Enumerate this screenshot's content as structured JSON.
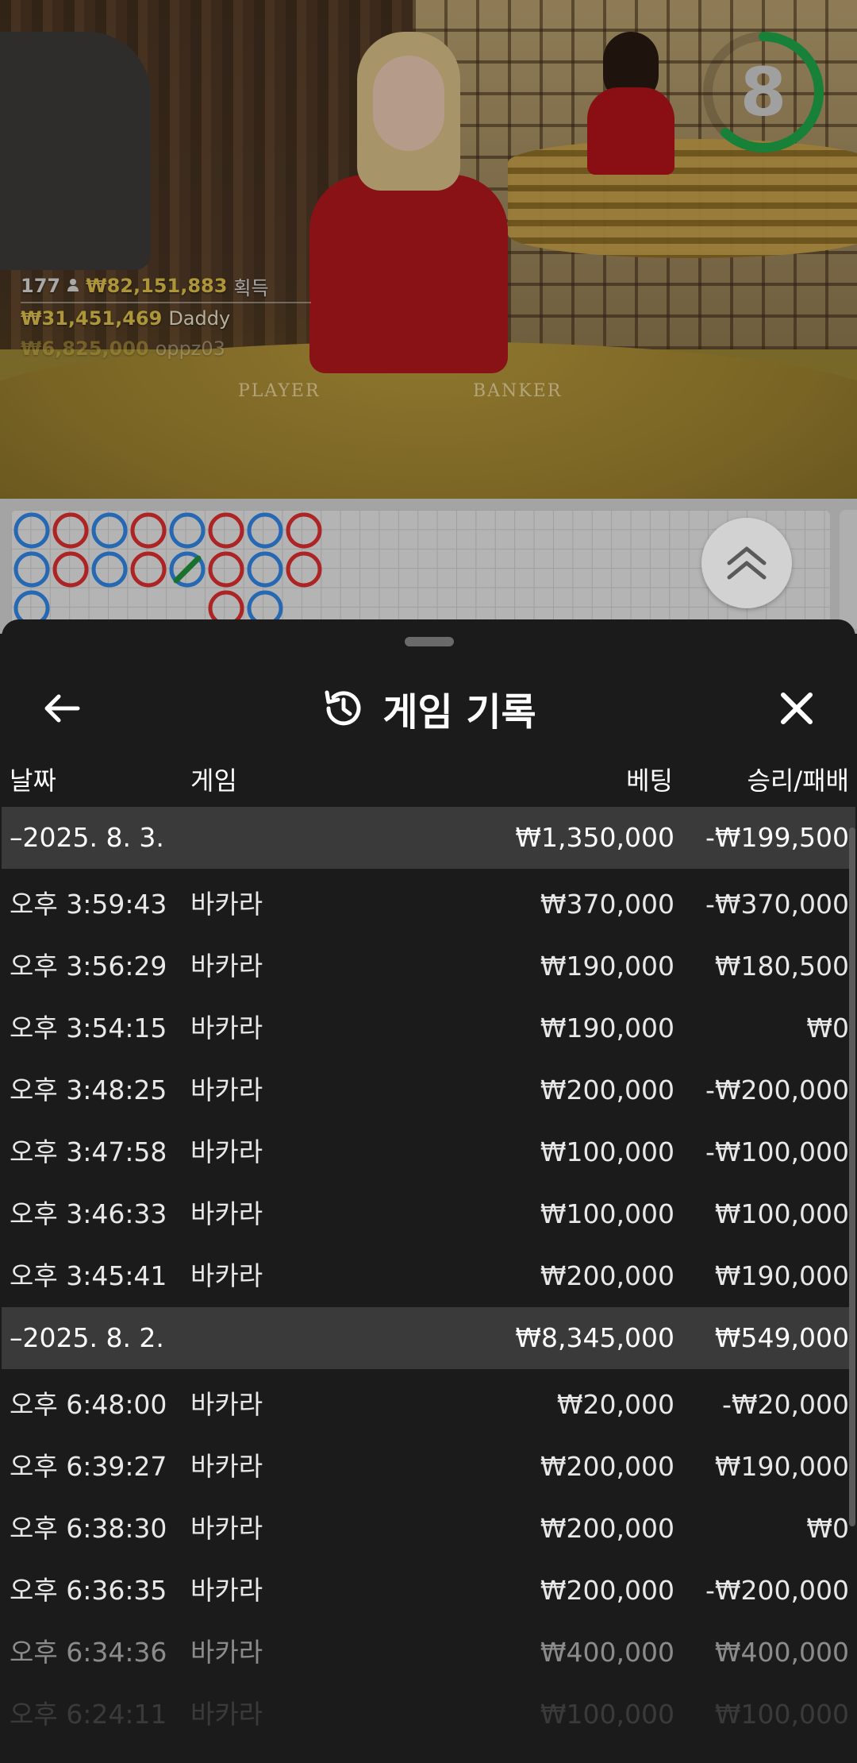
{
  "timer": {
    "value": "8",
    "progress": 0.62,
    "color": "#1fa64a"
  },
  "winners": {
    "count": "177",
    "total": "₩82,151,883",
    "total_suffix": "획득",
    "top1_amount": "₩31,451,469",
    "top1_name": "Daddy",
    "top2_amount": "₩6,825,000",
    "top2_name": "oppz03"
  },
  "table_labels": {
    "player": "PLAYER",
    "banker": "BANKER"
  },
  "roadmap": {
    "colors": {
      "player": "#2f7fd8",
      "banker": "#d22d2d",
      "tie": "#1f8a3a"
    },
    "columns": [
      [
        "P",
        "P",
        "P"
      ],
      [
        "B",
        "B"
      ],
      [
        "P",
        "P"
      ],
      [
        "B",
        "B"
      ],
      [
        "P",
        "T"
      ],
      [
        "B",
        "B",
        "B"
      ],
      [
        "P",
        "P",
        "P"
      ],
      [
        "B",
        "B"
      ]
    ]
  },
  "sheet": {
    "title": "게임 기록",
    "icons": {
      "back": "arrow-left-icon",
      "history": "history-icon",
      "close": "close-icon",
      "scroll_up": "chevron-double-up-icon"
    },
    "columns": {
      "date": "날짜",
      "game": "게임",
      "bet": "베팅",
      "result": "승리/패배"
    },
    "groups": [
      {
        "date": "–2025. 8. 3.",
        "bet": "₩1,350,000",
        "result": "-₩199,500",
        "rows": [
          {
            "time": "오후 3:59:43",
            "game": "바카라",
            "bet": "₩370,000",
            "result": "-₩370,000"
          },
          {
            "time": "오후 3:56:29",
            "game": "바카라",
            "bet": "₩190,000",
            "result": "₩180,500"
          },
          {
            "time": "오후 3:54:15",
            "game": "바카라",
            "bet": "₩190,000",
            "result": "₩0"
          },
          {
            "time": "오후 3:48:25",
            "game": "바카라",
            "bet": "₩200,000",
            "result": "-₩200,000"
          },
          {
            "time": "오후 3:47:58",
            "game": "바카라",
            "bet": "₩100,000",
            "result": "-₩100,000"
          },
          {
            "time": "오후 3:46:33",
            "game": "바카라",
            "bet": "₩100,000",
            "result": "₩100,000"
          },
          {
            "time": "오후 3:45:41",
            "game": "바카라",
            "bet": "₩200,000",
            "result": "₩190,000"
          }
        ]
      },
      {
        "date": "–2025. 8. 2.",
        "bet": "₩8,345,000",
        "result": "₩549,000",
        "rows": [
          {
            "time": "오후 6:48:00",
            "game": "바카라",
            "bet": "₩20,000",
            "result": "-₩20,000"
          },
          {
            "time": "오후 6:39:27",
            "game": "바카라",
            "bet": "₩200,000",
            "result": "₩190,000"
          },
          {
            "time": "오후 6:38:30",
            "game": "바카라",
            "bet": "₩200,000",
            "result": "₩0"
          },
          {
            "time": "오후 6:36:35",
            "game": "바카라",
            "bet": "₩200,000",
            "result": "-₩200,000"
          },
          {
            "time": "오후 6:34:36",
            "game": "바카라",
            "bet": "₩400,000",
            "result": "₩400,000"
          },
          {
            "time": "오후 6:24:11",
            "game": "바카라",
            "bet": "₩100,000",
            "result": "₩100,000"
          }
        ]
      }
    ]
  }
}
